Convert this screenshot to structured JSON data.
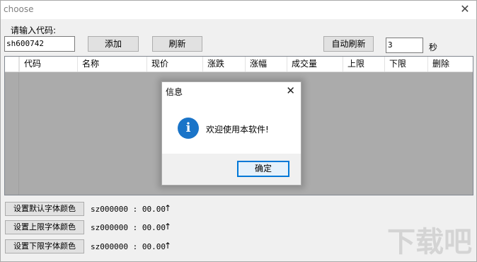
{
  "window": {
    "title": "choose",
    "close_glyph": "✕"
  },
  "input_label": "请输入代码:",
  "code_input": {
    "value": "sh600742"
  },
  "buttons": {
    "add": "添加",
    "refresh": "刷新",
    "auto_refresh": "自动刷新"
  },
  "interval": {
    "value": "3",
    "unit": "秒"
  },
  "grid": {
    "columns": [
      "代码",
      "名称",
      "现价",
      "涨跌",
      "涨幅",
      "成交量",
      "上限",
      "下限",
      "删除"
    ],
    "rows": []
  },
  "settings": [
    {
      "label": "设置默认字体颜色",
      "status": "sz000000 : 00.00",
      "arrow": "↑"
    },
    {
      "label": "设置上限字体颜色",
      "status": "sz000000 : 00.00",
      "arrow": "↑"
    },
    {
      "label": "设置下限字体颜色",
      "status": "sz000000 : 00.00",
      "arrow": "↑"
    }
  ],
  "dialog": {
    "title": "信息",
    "close_glyph": "✕",
    "icon": "info-icon",
    "icon_glyph": "i",
    "message": "欢迎使用本软件!",
    "ok_label": "确定"
  },
  "watermark": "下载吧",
  "colors": {
    "accent": "#0078d7",
    "info_icon": "#1a74c8",
    "grid_bg": "#ababab",
    "window_bg": "#f0f0f0"
  }
}
